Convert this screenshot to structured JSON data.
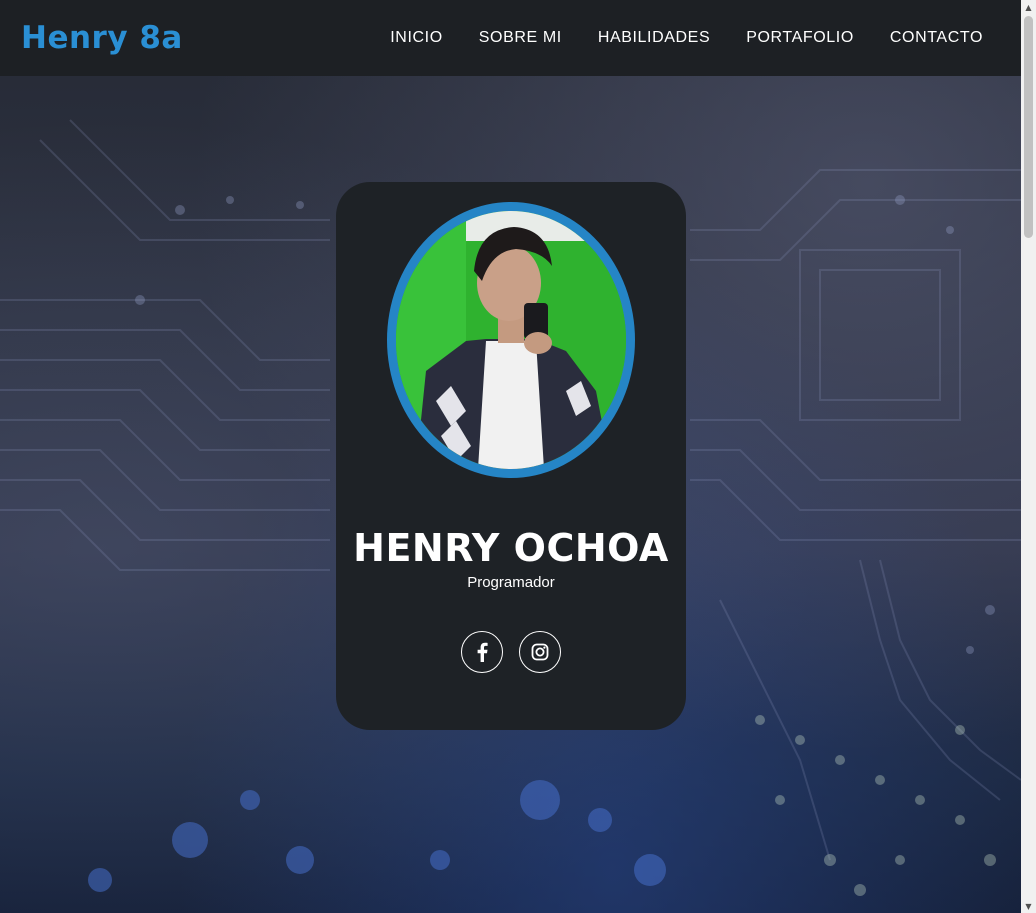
{
  "header": {
    "brand": "Henry 8a",
    "nav": [
      "INICIO",
      "SOBRE MI",
      "HABILIDADES",
      "PORTAFOLIO",
      "CONTACTO"
    ]
  },
  "profile": {
    "name": "HENRY OCHOA",
    "role": "Programador",
    "photo_icon": "profile-photo"
  },
  "socials": [
    {
      "icon": "facebook-icon"
    },
    {
      "icon": "instagram-icon"
    }
  ],
  "colors": {
    "accent": "#2585c6",
    "brand": "#2a8fd4",
    "navbar_bg": "#1d2024",
    "card_bg": "#1e2226"
  }
}
